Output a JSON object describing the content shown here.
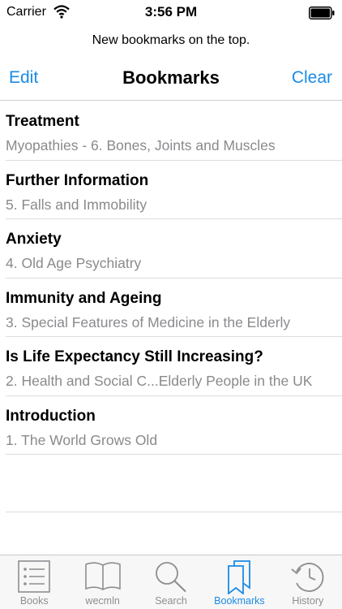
{
  "status": {
    "carrier": "Carrier",
    "time": "3:56 PM"
  },
  "notice": "New bookmarks on the top.",
  "nav": {
    "left": "Edit",
    "title": "Bookmarks",
    "right": "Clear"
  },
  "bookmarks": [
    {
      "title": "Treatment",
      "subtitle": "Myopathies - 6. Bones, Joints and Muscles"
    },
    {
      "title": "Further Information",
      "subtitle": "5. Falls and Immobility"
    },
    {
      "title": "Anxiety",
      "subtitle": "4. Old Age Psychiatry"
    },
    {
      "title": "Immunity and Ageing",
      "subtitle": "3. Special Features of Medicine in the Elderly"
    },
    {
      "title": "Is Life Expectancy Still Increasing?",
      "subtitle": "2. Health and Social C...Elderly People in the UK"
    },
    {
      "title": "Introduction",
      "subtitle": "1. The World Grows Old"
    }
  ],
  "tabs": [
    {
      "label": "Books",
      "icon": "list-icon"
    },
    {
      "label": "wecmln",
      "icon": "book-icon"
    },
    {
      "label": "Search",
      "icon": "search-icon"
    },
    {
      "label": "Bookmarks",
      "icon": "bookmarks-icon",
      "active": true
    },
    {
      "label": "History",
      "icon": "clock-icon"
    }
  ],
  "colors": {
    "accent": "#1a8be6",
    "inactive": "#8e8e93"
  }
}
